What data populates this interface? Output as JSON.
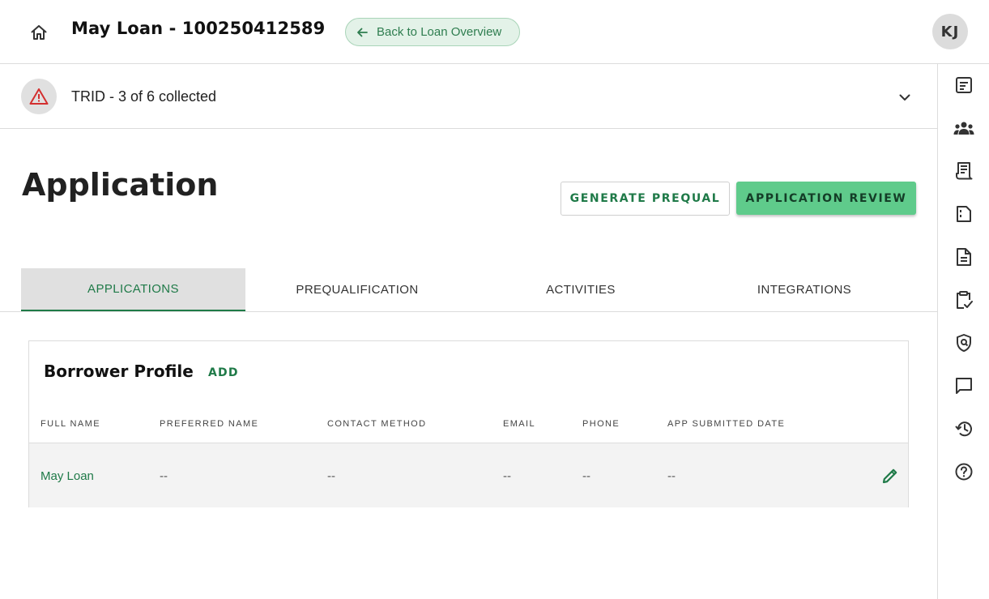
{
  "header": {
    "home_icon": "home-icon",
    "loan_title": "May Loan - 100250412589",
    "back_button_label": "Back to Loan Overview",
    "back_icon": "arrow-left-icon",
    "avatar_initials": "KJ"
  },
  "trid": {
    "status_text": "TRID - 3 of 6 collected",
    "warning_icon": "warning-triangle-icon",
    "expand_icon": "chevron-down-icon"
  },
  "page": {
    "title": "Application",
    "generate_prequal_label": "GENERATE PREQUAL",
    "application_review_label": "APPLICATION REVIEW"
  },
  "tabs": [
    {
      "label": "APPLICATIONS",
      "active": true
    },
    {
      "label": "PREQUALIFICATION",
      "active": false
    },
    {
      "label": "ACTIVITIES",
      "active": false
    },
    {
      "label": "INTEGRATIONS",
      "active": false
    }
  ],
  "borrower_profile": {
    "title": "Borrower Profile",
    "add_label": "ADD",
    "columns": [
      "FULL NAME",
      "PREFERRED NAME",
      "CONTACT METHOD",
      "EMAIL",
      "PHONE",
      "APP SUBMITTED DATE"
    ],
    "rows": [
      {
        "full_name": "May Loan",
        "preferred_name": "--",
        "contact_method": "--",
        "email": "--",
        "phone": "--",
        "app_submitted_date": "--"
      }
    ]
  },
  "right_rail": {
    "icons": [
      "summary-icon",
      "people-icon",
      "receipt-icon",
      "documents-icon",
      "file-icon",
      "checklist-icon",
      "security-icon",
      "chat-icon",
      "history-icon",
      "help-icon"
    ]
  },
  "colors": {
    "brand_green": "#1f7a48",
    "primary_button": "#5fcb8b",
    "warning_red": "#d32f2f",
    "back_button_bg": "#e3f2e8"
  }
}
